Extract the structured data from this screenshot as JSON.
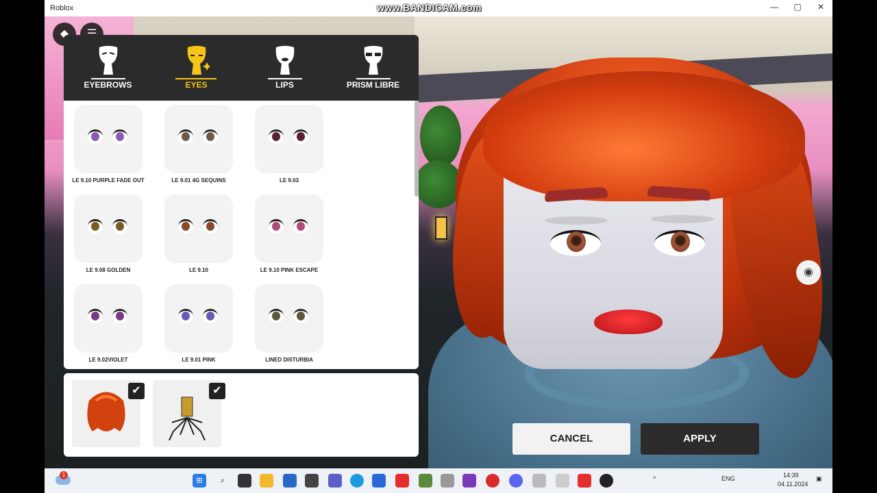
{
  "window": {
    "title": "Roblox",
    "watermark": "www.BANDICAM.com"
  },
  "window_controls": {
    "minimize": "—",
    "maximize": "▢",
    "close": "✕"
  },
  "top_buttons": {
    "menu_icon": "☰"
  },
  "tabs": [
    {
      "label": "EYEBROWS",
      "active": false
    },
    {
      "label": "EYES",
      "active": true
    },
    {
      "label": "LIPS",
      "active": false
    },
    {
      "label": "PRISM LIBRE",
      "active": false
    }
  ],
  "items": [
    {
      "name": "LE 9.10 PURPLE FADE OUT",
      "color": "#8a5ab8"
    },
    {
      "name": "LE 9.01 4G SEQUINS",
      "color": "#6e5a4a"
    },
    {
      "name": "LE 9.03",
      "color": "#5a1e3a"
    },
    {
      "name": "LE 9.08 GOLDEN",
      "color": "#7a5a20"
    },
    {
      "name": "LE 9.10",
      "color": "#8a4a28"
    },
    {
      "name": "LE 9.10 PINK ESCAPE",
      "color": "#b04a7a"
    },
    {
      "name": "LE 9.02VIOLET",
      "color": "#7a3a8a"
    },
    {
      "name": "LE 9.01 PINK",
      "color": "#6a5ab8"
    },
    {
      "name": "LINED DISTURBIA",
      "color": "#5a5a3a"
    }
  ],
  "owned_items": [
    {
      "name": "hair",
      "checked": "✔"
    },
    {
      "name": "spider-accessory",
      "checked": "✔"
    }
  ],
  "buttons": {
    "cancel": "CANCEL",
    "apply": "APPLY"
  },
  "taskbar": {
    "weather_badge": "1",
    "tray_lang": "ENG",
    "time": "14:39",
    "date": "04.11.2024"
  },
  "colors": {
    "accent": "#f5c518",
    "panel_dark": "#2b2b2b"
  }
}
